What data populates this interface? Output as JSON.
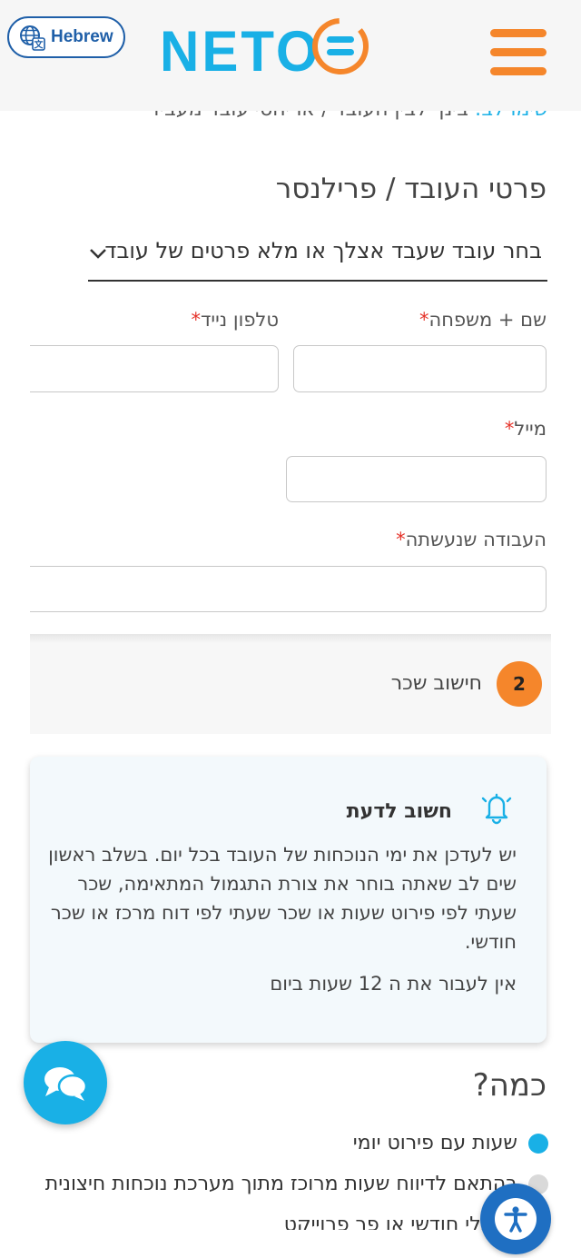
{
  "header": {
    "language_label": "Hebrew",
    "logo_text": "NETO",
    "brand_colors": {
      "blue": "#19b0e6",
      "orange": "#f5862b",
      "dark_blue": "#1f5fa8"
    }
  },
  "cut_text": {
    "teal_part": "שימו לב:",
    "rest": "בינך לבין העובד / או יחסי עובד מעביד"
  },
  "worker_section": {
    "title": "פרטי העובד / פרילנסר",
    "select_text": "בחר עובד שעבד אצלך או מלא פרטים של עובד"
  },
  "fields": {
    "name_label": "שם + משפחה",
    "phone_label": "טלפון נייד",
    "email_label": "מייל",
    "work_label": "העבודה שנעשתה",
    "required_mark": "*"
  },
  "step": {
    "number": "2",
    "label": "חישוב שכר"
  },
  "info": {
    "title": "חשוב לדעת",
    "body": "יש לעדכן את ימי הנוכחות של העובד בכל יום. בשלב ראשון שים לב שאתה בוחר את צורת התגמול המתאימה, שכר שעתי לפי פירוט שעות או שכר שעתי לפי דוח מרכז או שכר חודשי.",
    "note": "אין לעבור את ה 12 שעות ביום"
  },
  "how_much": {
    "title": "כמה?",
    "options": [
      {
        "label": "שעות עם פירוט יומי",
        "selected": true
      },
      {
        "label": "בהתאם לדיווח שעות מרוכז מתוך מערכת נוכחות חיצונית",
        "selected": false
      },
      {
        "label": "גלובלי חודשי או פר פרוייקט",
        "selected": false
      }
    ]
  }
}
